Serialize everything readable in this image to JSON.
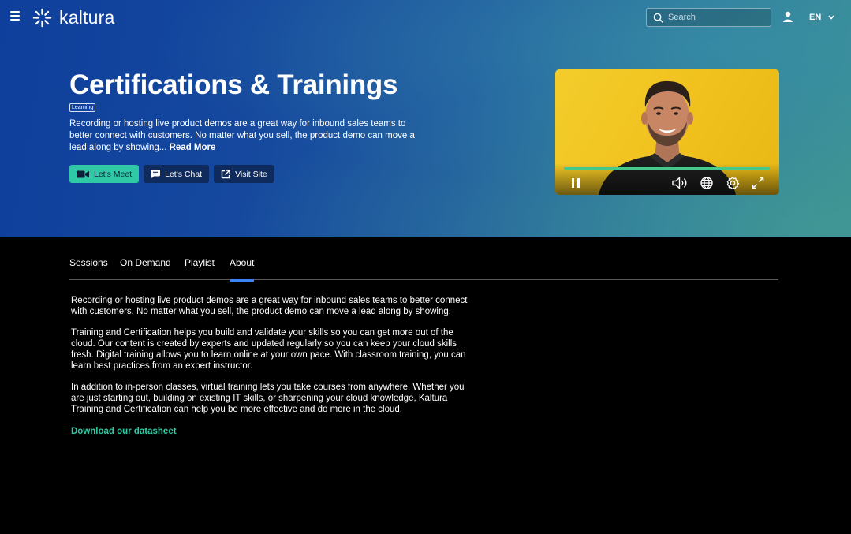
{
  "header": {
    "brand": "kaltura",
    "search_placeholder": "Search",
    "language": "EN"
  },
  "hero": {
    "title": "Certifications & Trainings",
    "badge": "Learning",
    "description": "Recording or hosting live product demos are a great way for inbound sales teams to better connect with customers. No matter what you sell, the product demo can move a lead along by showing...",
    "read_more": "Read More",
    "buttons": {
      "meet": "Let's Meet",
      "chat": "Let's Chat",
      "visit": "Visit Site"
    }
  },
  "player": {
    "progress": 1.0,
    "controls": [
      "pause-icon",
      "volume-icon",
      "globe-icon",
      "settings-icon",
      "fullscreen-icon"
    ]
  },
  "tabs": [
    "Sessions",
    "On Demand",
    "Playlist",
    "About"
  ],
  "active_tab": "About",
  "about": {
    "paragraphs": [
      "Recording or hosting live product demos are a great way for inbound sales teams to better connect with customers. No matter what you sell, the product demo can move a lead along by showing.",
      "Training and Certification helps you build and validate your skills so you can get more out of the cloud. Our content is created by experts and updated regularly so you can keep your cloud skills fresh. Digital training allows you to learn online at your own pace. With classroom training, you can learn best practices from an expert instructor.",
      "In addition to in-person classes, virtual training lets you take courses from anywhere. Whether you are just starting out, building on existing IT skills, or sharpening your cloud knowledge, Kaltura Training and Certification can help you be more effective and do more in the cloud."
    ],
    "link": "Download our datasheet"
  },
  "colors": {
    "accent": "#2fc9a5",
    "tab_underline": "#3b82f6",
    "button_dark": "#0f2a5c"
  }
}
